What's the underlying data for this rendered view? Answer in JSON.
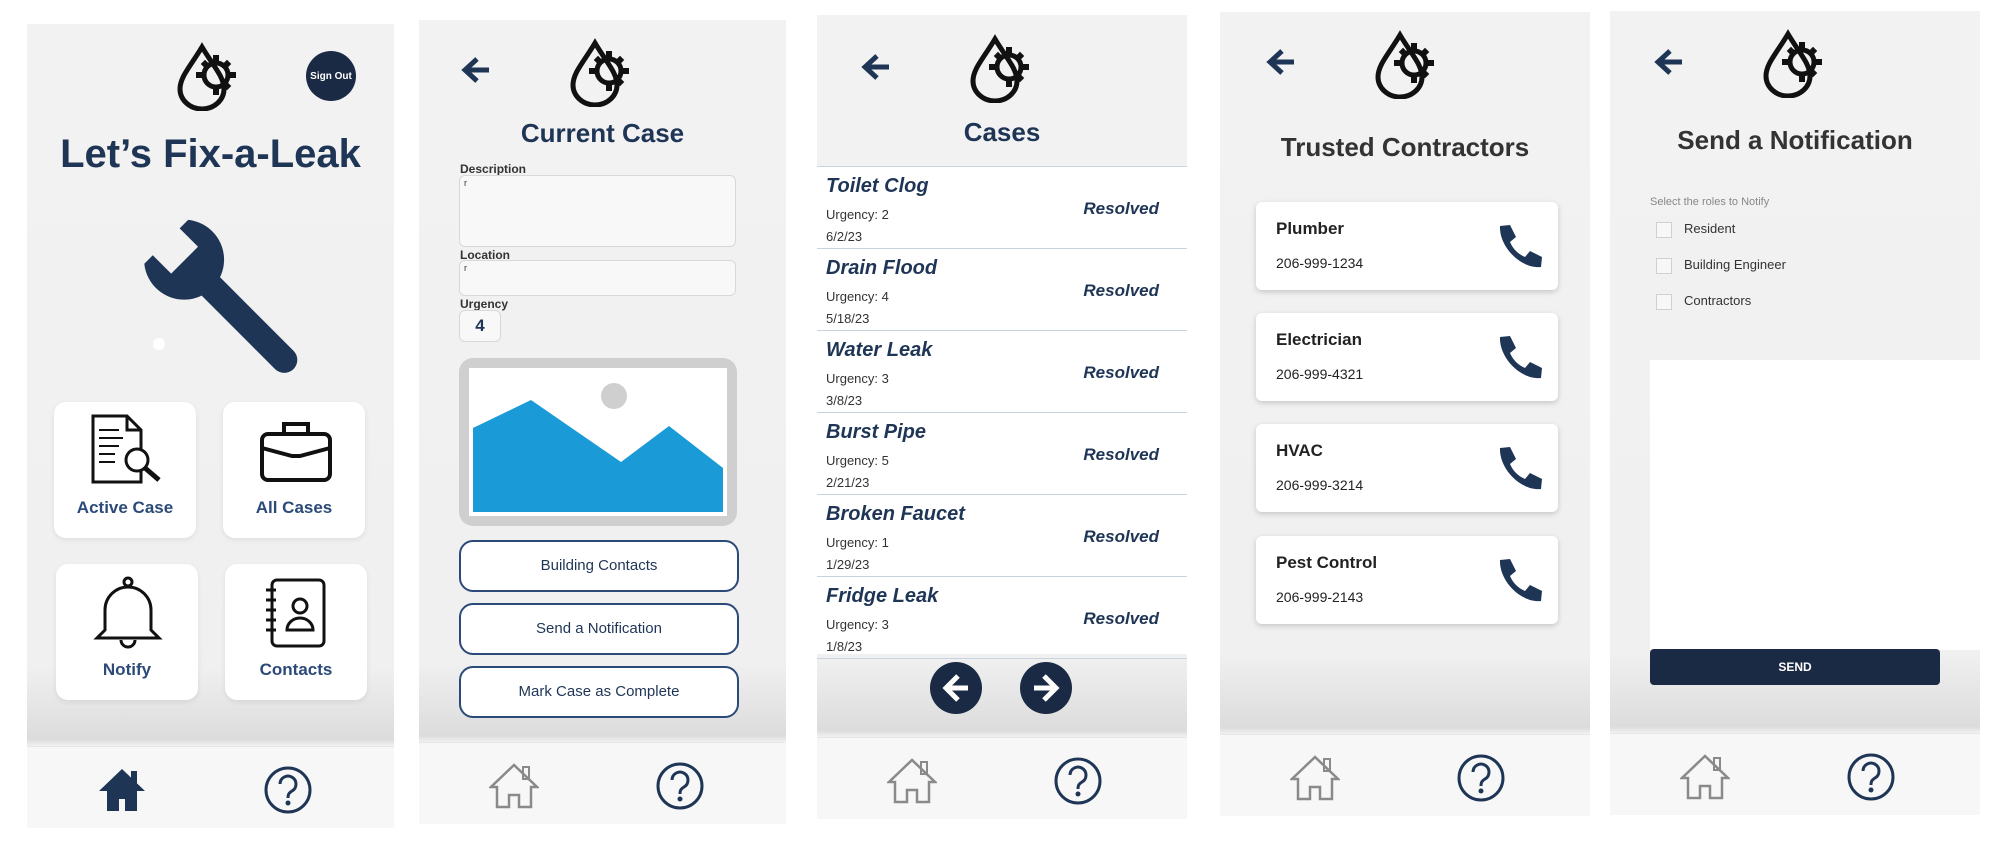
{
  "colors": {
    "navy": "#1f3556",
    "dark": "#1b2a44",
    "tile_label": "#2b4a79",
    "image_blue": "#1a9ad6"
  },
  "screen1": {
    "title": "Let’s Fix-a-Leak",
    "signout_label": "Sign Out",
    "tiles": [
      {
        "label": "Active Case",
        "icon": "document-search-icon"
      },
      {
        "label": "All Cases",
        "icon": "briefcase-icon"
      },
      {
        "label": "Notify",
        "icon": "bell-icon"
      },
      {
        "label": "Contacts",
        "icon": "contacts-book-icon"
      }
    ]
  },
  "screen2": {
    "title": "Current Case",
    "description_label": "Description",
    "description_value": "r",
    "location_label": "Location",
    "location_value": "r",
    "urgency_label": "Urgency",
    "urgency_value": "4",
    "buttons": [
      "Building Contacts",
      "Send a Notification",
      "Mark Case as Complete"
    ]
  },
  "screen3": {
    "title": "Cases",
    "cases": [
      {
        "name": "Toilet Clog",
        "urgency": "Urgency: 2",
        "date": "6/2/23",
        "status": "Resolved"
      },
      {
        "name": "Drain Flood",
        "urgency": "Urgency: 4",
        "date": "5/18/23",
        "status": "Resolved"
      },
      {
        "name": "Water Leak",
        "urgency": "Urgency: 3",
        "date": "3/8/23",
        "status": "Resolved"
      },
      {
        "name": "Burst Pipe",
        "urgency": "Urgency: 5",
        "date": "2/21/23",
        "status": "Resolved"
      },
      {
        "name": "Broken Faucet",
        "urgency": "Urgency: 1",
        "date": "1/29/23",
        "status": "Resolved"
      },
      {
        "name": "Fridge Leak",
        "urgency": "Urgency: 3",
        "date": "1/8/23",
        "status": "Resolved"
      }
    ]
  },
  "screen4": {
    "title": "Trusted Contractors",
    "contractors": [
      {
        "name": "Plumber",
        "phone": "206-999-1234"
      },
      {
        "name": "Electrician",
        "phone": "206-999-4321"
      },
      {
        "name": "HVAC",
        "phone": "206-999-3214"
      },
      {
        "name": "Pest Control",
        "phone": "206-999-2143"
      }
    ]
  },
  "screen5": {
    "title": "Send a Notification",
    "instruction": "Select the roles to Notify",
    "roles": [
      "Resident",
      "Building Engineer",
      "Contractors"
    ],
    "send_label": "SEND"
  }
}
